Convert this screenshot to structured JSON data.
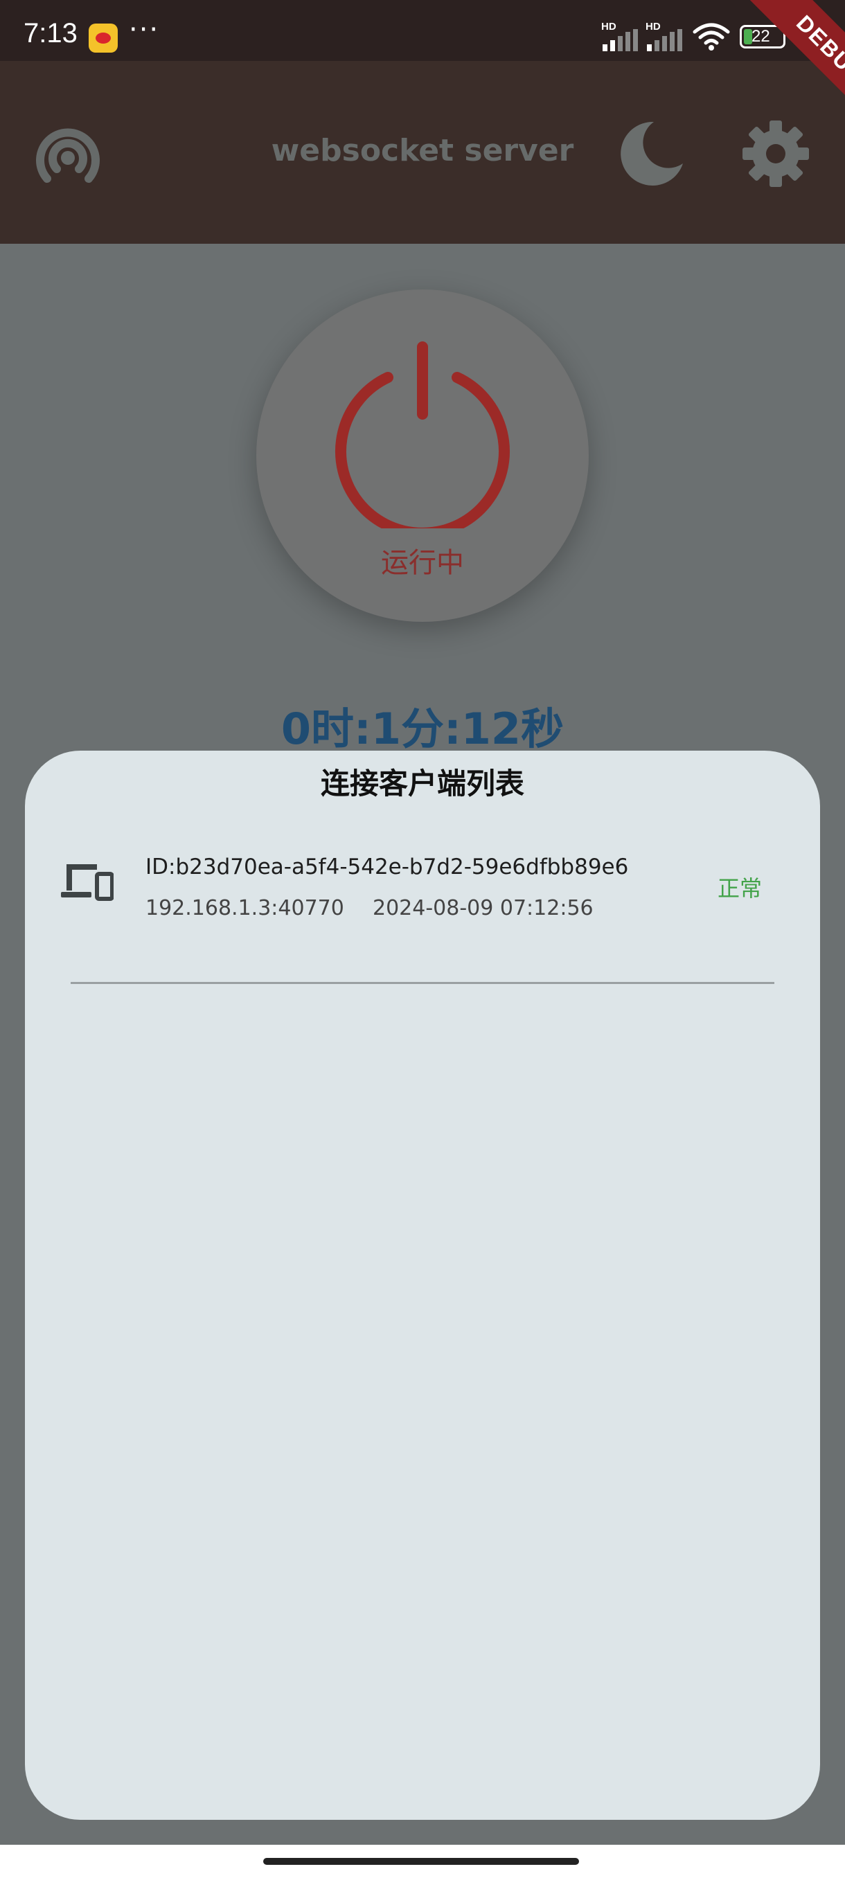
{
  "status_bar": {
    "time": "7:13",
    "more": "···",
    "signal_1_label": "HD",
    "signal_2_label": "HD",
    "battery_level": "22"
  },
  "debug_banner": {
    "label": "DEBUG"
  },
  "app_bar": {
    "title": "websocket server",
    "left_icon": "broadcast-icon",
    "theme_icon": "moon-icon",
    "settings_icon": "gear-icon"
  },
  "power": {
    "status_label": "运行中",
    "color": "#9c2a27"
  },
  "timer": {
    "text": "0时:1分:12秒"
  },
  "client_sheet": {
    "title": "连接客户端列表",
    "clients": [
      {
        "id": "ID:b23d70ea-a5f4-542e-b7d2-59e6dfbb89e6",
        "address": "192.168.1.3:40770",
        "connected_at": "2024-08-09 07:12:56",
        "status": "正常",
        "icon": "devices-icon"
      }
    ]
  },
  "colors": {
    "app_bar": "#3b2d29",
    "sheet": "#dde5e8",
    "status_ok": "#43a34a",
    "timer": "#1f4c72"
  }
}
